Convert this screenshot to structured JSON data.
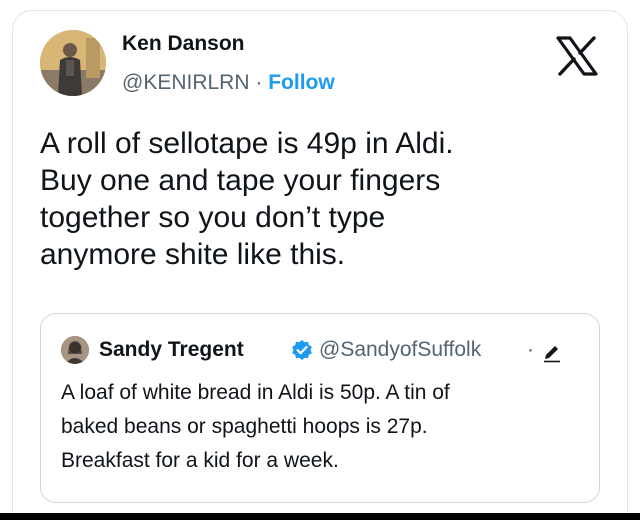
{
  "author": {
    "name": "Ken Danson",
    "handle": "@KENIRLRN",
    "separator": "·",
    "follow_label": "Follow"
  },
  "tweet": {
    "text": "A roll of sellotape is 49p in Aldi.\nBuy one and tape your fingers\ntogether so you don’t type\nanymore shite like this."
  },
  "quoted": {
    "name": "Sandy Tregent",
    "handle": "@SandyofSuffolk",
    "separator": "·",
    "text": "A loaf of white bread in Aldi is 50p.  A tin of\nbaked beans or spaghetti hoops is  27p.\nBreakfast for a kid for a week."
  },
  "colors": {
    "link_blue": "#1d9bf0",
    "text_primary": "#0f1419",
    "text_secondary": "#536471",
    "border": "#cfd9de",
    "verified_badge": "#1d9bf0"
  },
  "icons": {
    "platform_logo": "x-logo-icon",
    "verified": "verified-badge-icon",
    "edited": "pencil-edit-icon"
  }
}
